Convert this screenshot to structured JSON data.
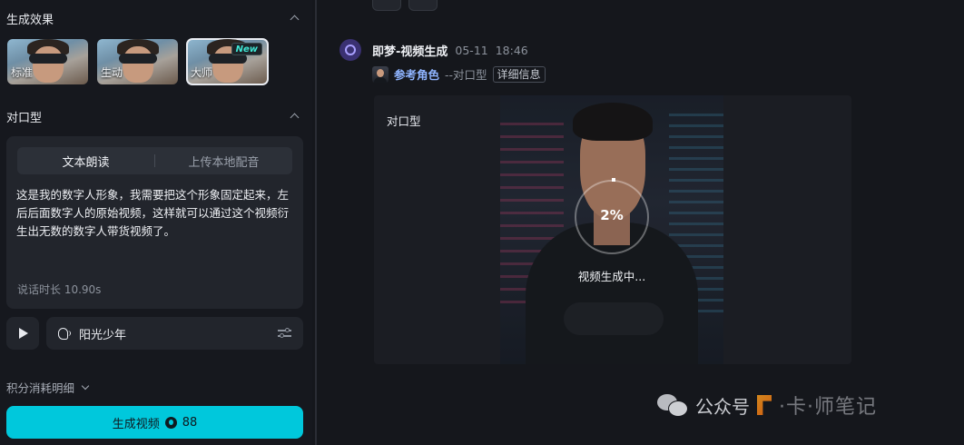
{
  "left": {
    "effect_section": {
      "title": "生成效果"
    },
    "effects": [
      {
        "label": "标准",
        "active": false,
        "badge": ""
      },
      {
        "label": "生动",
        "active": false,
        "badge": ""
      },
      {
        "label": "大师",
        "active": true,
        "badge": "New"
      }
    ],
    "mouth_section": {
      "title": "对口型"
    },
    "tabs": [
      {
        "label": "文本朗读",
        "active": true
      },
      {
        "label": "上传本地配音",
        "active": false
      }
    ],
    "script_text": "这是我的数字人形象，我需要把这个形象固定起来，左后后面数字人的原始视频，这样就可以通过这个视频衍生出无数的数字人带货视频了。",
    "duration_label": "说话时长 10.90s",
    "voice_name": "阳光少年",
    "credits_label": "积分消耗明细",
    "generate_button": {
      "label": "生成视频",
      "cost": "88"
    }
  },
  "message": {
    "title": "即梦-视频生成",
    "date": "05-11",
    "time": "18:46",
    "ref_label": "参考角色",
    "ref_type": "--对口型",
    "detail_button": "详细信息",
    "card_label": "对口型",
    "progress": "2%",
    "progress_value": 0.02,
    "status": "视频生成中..."
  },
  "watermark": {
    "text": "公众号",
    "tail": "·卡·师笔记"
  },
  "colors": {
    "accent": "#00c8dc",
    "background": "#15171c",
    "panel": "#22252c",
    "ref_link": "#8fb4ff"
  }
}
